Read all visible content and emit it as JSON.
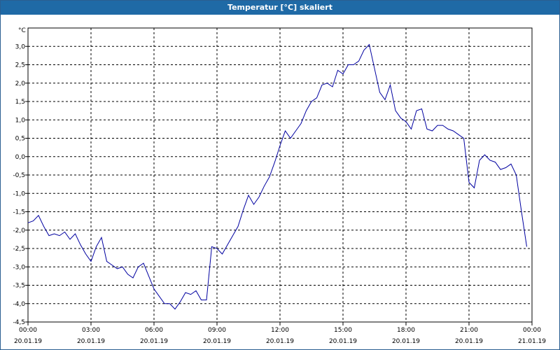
{
  "window": {
    "title": "Temperatur [°C] skaliert"
  },
  "colors": {
    "titlebar": "#1f6aa6",
    "series": "#0000a0",
    "grid": "#000000"
  },
  "chart_data": {
    "type": "line",
    "title": "Temperatur [°C] skaliert",
    "ylabel": "°C",
    "xlabel": "",
    "grid": true,
    "grid_style": "dashed",
    "ylim": [
      -4.5,
      3.5
    ],
    "yticks": [
      "3,0",
      "2,5",
      "2,0",
      "1,5",
      "1,0",
      "0,5",
      "0,0",
      "-0,5",
      "-1,0",
      "-1,5",
      "-2,0",
      "-2,5",
      "-3,0",
      "-3,5",
      "-4,0",
      "-4,5"
    ],
    "ytick_values": [
      3.0,
      2.5,
      2.0,
      1.5,
      1.0,
      0.5,
      0.0,
      -0.5,
      -1.0,
      -1.5,
      -2.0,
      -2.5,
      -3.0,
      -3.5,
      -4.0,
      -4.5
    ],
    "xlim": [
      "2019-01-20T00:00",
      "2019-01-21T00:00"
    ],
    "xticks": [
      {
        "time": "00:00",
        "date": "20.01.19"
      },
      {
        "time": "03:00",
        "date": "20.01.19"
      },
      {
        "time": "06:00",
        "date": "20.01.19"
      },
      {
        "time": "09:00",
        "date": "20.01.19"
      },
      {
        "time": "12:00",
        "date": "20.01.19"
      },
      {
        "time": "15:00",
        "date": "20.01.19"
      },
      {
        "time": "18:00",
        "date": "20.01.19"
      },
      {
        "time": "21:00",
        "date": "20.01.19"
      },
      {
        "time": "00:00",
        "date": "21.01.19"
      }
    ],
    "series": [
      {
        "x": [
          "2019-01-20T00:00",
          "2019-01-20T00:15",
          "2019-01-20T00:30",
          "2019-01-20T00:45",
          "2019-01-20T01:00",
          "2019-01-20T01:15",
          "2019-01-20T01:30",
          "2019-01-20T01:45",
          "2019-01-20T02:00",
          "2019-01-20T02:15",
          "2019-01-20T02:30",
          "2019-01-20T02:45",
          "2019-01-20T03:00",
          "2019-01-20T03:15",
          "2019-01-20T03:30",
          "2019-01-20T03:45",
          "2019-01-20T04:00",
          "2019-01-20T04:15",
          "2019-01-20T04:30",
          "2019-01-20T04:45",
          "2019-01-20T05:00",
          "2019-01-20T05:15",
          "2019-01-20T05:30",
          "2019-01-20T05:45",
          "2019-01-20T06:00",
          "2019-01-20T06:15",
          "2019-01-20T06:30",
          "2019-01-20T06:45",
          "2019-01-20T07:00",
          "2019-01-20T07:15",
          "2019-01-20T07:30",
          "2019-01-20T07:45",
          "2019-01-20T08:00",
          "2019-01-20T08:15",
          "2019-01-20T08:30",
          "2019-01-20T08:45",
          "2019-01-20T09:00",
          "2019-01-20T09:15",
          "2019-01-20T09:30",
          "2019-01-20T09:45",
          "2019-01-20T10:00",
          "2019-01-20T10:15",
          "2019-01-20T10:30",
          "2019-01-20T10:45",
          "2019-01-20T11:00",
          "2019-01-20T11:15",
          "2019-01-20T11:30",
          "2019-01-20T11:45",
          "2019-01-20T12:00",
          "2019-01-20T12:15",
          "2019-01-20T12:30",
          "2019-01-20T12:45",
          "2019-01-20T13:00",
          "2019-01-20T13:15",
          "2019-01-20T13:30",
          "2019-01-20T13:45",
          "2019-01-20T14:00",
          "2019-01-20T14:15",
          "2019-01-20T14:30",
          "2019-01-20T14:45",
          "2019-01-20T15:00",
          "2019-01-20T15:15",
          "2019-01-20T15:30",
          "2019-01-20T15:45",
          "2019-01-20T16:00",
          "2019-01-20T16:15",
          "2019-01-20T16:30",
          "2019-01-20T16:45",
          "2019-01-20T17:00",
          "2019-01-20T17:15",
          "2019-01-20T17:30",
          "2019-01-20T17:45",
          "2019-01-20T18:00",
          "2019-01-20T18:15",
          "2019-01-20T18:30",
          "2019-01-20T18:45",
          "2019-01-20T19:00",
          "2019-01-20T19:15",
          "2019-01-20T19:30",
          "2019-01-20T19:45",
          "2019-01-20T20:00",
          "2019-01-20T20:15",
          "2019-01-20T20:30",
          "2019-01-20T20:45",
          "2019-01-20T21:00",
          "2019-01-20T21:15",
          "2019-01-20T21:30",
          "2019-01-20T21:45",
          "2019-01-20T22:00",
          "2019-01-20T22:15",
          "2019-01-20T22:30",
          "2019-01-20T22:45",
          "2019-01-20T23:00",
          "2019-01-20T23:15",
          "2019-01-20T23:30",
          "2019-01-20T23:45"
        ],
        "values": [
          -1.8,
          -1.75,
          -1.6,
          -1.9,
          -2.15,
          -2.1,
          -2.15,
          -2.05,
          -2.25,
          -2.1,
          -2.4,
          -2.65,
          -2.85,
          -2.45,
          -2.2,
          -2.85,
          -2.95,
          -3.05,
          -3.0,
          -3.2,
          -3.3,
          -3.0,
          -2.9,
          -3.25,
          -3.6,
          -3.8,
          -4.0,
          -4.0,
          -4.15,
          -3.95,
          -3.7,
          -3.75,
          -3.65,
          -3.9,
          -3.9,
          -2.45,
          -2.5,
          -2.65,
          -2.4,
          -2.15,
          -1.9,
          -1.45,
          -1.05,
          -1.3,
          -1.1,
          -0.8,
          -0.55,
          -0.15,
          0.3,
          0.7,
          0.5,
          0.7,
          0.9,
          1.25,
          1.5,
          1.6,
          1.95,
          2.0,
          1.9,
          2.35,
          2.25,
          2.5,
          2.5,
          2.6,
          2.9,
          3.05,
          2.4,
          1.75,
          1.55,
          1.95,
          1.25,
          1.05,
          0.95,
          0.75,
          1.25,
          1.3,
          0.75,
          0.7,
          0.85,
          0.85,
          0.75,
          0.7,
          0.6,
          0.5,
          -0.7,
          -0.85,
          -0.1,
          0.05,
          -0.1,
          -0.15,
          -0.35,
          -0.3,
          -0.2,
          -0.5,
          -1.5,
          -2.45
        ]
      }
    ]
  }
}
